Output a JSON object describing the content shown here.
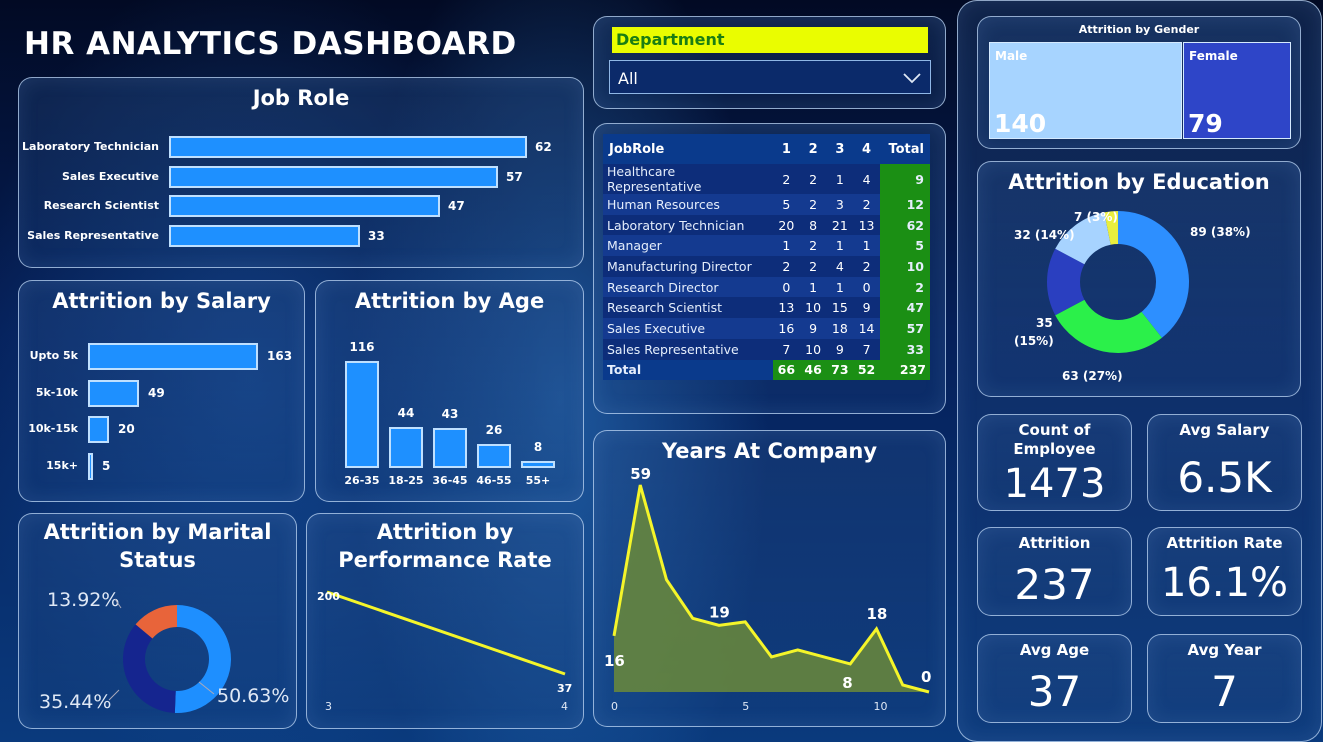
{
  "title": "HR ANALYTICS DASHBOARD",
  "job_role": {
    "title": "Job Role",
    "items": [
      {
        "label": "Laboratory Technician",
        "value": 62
      },
      {
        "label": "Sales Executive",
        "value": 57
      },
      {
        "label": "Research Scientist",
        "value": 47
      },
      {
        "label": "Sales Representative",
        "value": 33
      }
    ]
  },
  "salary": {
    "title": "Attrition by Salary",
    "items": [
      {
        "label": "Upto 5k",
        "value": 163
      },
      {
        "label": "5k-10k",
        "value": 49
      },
      {
        "label": "10k-15k",
        "value": 20
      },
      {
        "label": "15k+",
        "value": 5
      }
    ]
  },
  "age": {
    "title": "Attrition by Age",
    "items": [
      {
        "label": "26-35",
        "value": 116
      },
      {
        "label": "18-25",
        "value": 44
      },
      {
        "label": "36-45",
        "value": 43
      },
      {
        "label": "46-55",
        "value": 26
      },
      {
        "label": "55+",
        "value": 8
      }
    ]
  },
  "marital": {
    "title": "Attrition by Marital Status",
    "title_line1": "Attrition by Marital",
    "title_line2": "Status",
    "labels": [
      "13.92%",
      "35.44%",
      "50.63%"
    ],
    "colors": [
      "#e8643a",
      "#15258f",
      "#1e8fff"
    ]
  },
  "performance": {
    "title_line1": "Attrition by",
    "title_line2": "Performance Rate",
    "x_labels": [
      "3",
      "4"
    ],
    "point_labels": [
      "200",
      "37"
    ]
  },
  "department": {
    "label": "Department",
    "selected": "All",
    "chevron_icon": "chevron-down-icon"
  },
  "table": {
    "headers": [
      "JobRole",
      "1",
      "2",
      "3",
      "4",
      "Total"
    ],
    "rows": [
      [
        "Healthcare Representative",
        "2",
        "2",
        "1",
        "4",
        "9"
      ],
      [
        "Human Resources",
        "5",
        "2",
        "3",
        "2",
        "12"
      ],
      [
        "Laboratory Technician",
        "20",
        "8",
        "21",
        "13",
        "62"
      ],
      [
        "Manager",
        "1",
        "2",
        "1",
        "1",
        "5"
      ],
      [
        "Manufacturing Director",
        "2",
        "2",
        "4",
        "2",
        "10"
      ],
      [
        "Research Director",
        "0",
        "1",
        "1",
        "0",
        "2"
      ],
      [
        "Research Scientist",
        "13",
        "10",
        "15",
        "9",
        "47"
      ],
      [
        "Sales Executive",
        "16",
        "9",
        "18",
        "14",
        "57"
      ],
      [
        "Sales Representative",
        "7",
        "10",
        "9",
        "7",
        "33"
      ]
    ],
    "total": [
      "Total",
      "66",
      "46",
      "73",
      "52",
      "237"
    ]
  },
  "years": {
    "title": "Years At Company",
    "x_ticks": [
      "0",
      "5",
      "10"
    ],
    "labels": [
      "16",
      "59",
      "19",
      "8",
      "18",
      "0"
    ]
  },
  "gender": {
    "title": "Attrition by Gender",
    "male_label": "Male",
    "male_value": "140",
    "female_label": "Female",
    "female_value": "79"
  },
  "education": {
    "title": "Attrition by Education",
    "labels": [
      "89 (38%)",
      "63 (27%)",
      "35",
      "(15%)",
      "32 (14%)",
      "7 (3%)"
    ],
    "colors": [
      "#2d8fff",
      "#2bf04a",
      "#2a3fc0",
      "#a7d3ff",
      "#e9ee3e",
      "#e07a5f"
    ]
  },
  "kpis": {
    "count_title_1": "Count of",
    "count_title_2": "Employee",
    "count_value": "1473",
    "salary_title": "Avg Salary",
    "salary_value": "6.5K",
    "attrition_title": "Attrition",
    "attrition_value": "237",
    "rate_title": "Attrition Rate",
    "rate_value": "16.1%",
    "age_title": "Avg Age",
    "age_value": "37",
    "year_title": "Avg Year",
    "year_value": "7"
  },
  "chart_data": [
    {
      "type": "bar",
      "title": "Job Role",
      "categories": [
        "Laboratory Technician",
        "Sales Executive",
        "Research Scientist",
        "Sales Representative"
      ],
      "values": [
        62,
        57,
        47,
        33
      ]
    },
    {
      "type": "bar",
      "title": "Attrition by Salary",
      "categories": [
        "Upto 5k",
        "5k-10k",
        "10k-15k",
        "15k+"
      ],
      "values": [
        163,
        49,
        20,
        5
      ]
    },
    {
      "type": "bar",
      "title": "Attrition by Age",
      "categories": [
        "26-35",
        "18-25",
        "36-45",
        "46-55",
        "55+"
      ],
      "values": [
        116,
        44,
        43,
        26,
        8
      ]
    },
    {
      "type": "pie",
      "title": "Attrition by Marital Status",
      "values": [
        13.92,
        35.44,
        50.63
      ]
    },
    {
      "type": "line",
      "title": "Attrition by Performance Rate",
      "x": [
        3,
        4
      ],
      "values": [
        200,
        37
      ]
    },
    {
      "type": "area",
      "title": "Years At Company",
      "x": [
        0,
        1,
        2,
        3,
        4,
        5,
        6,
        7,
        8,
        9,
        10,
        11,
        12
      ],
      "values": [
        16,
        59,
        32,
        21,
        19,
        20,
        10,
        12,
        10,
        8,
        18,
        2,
        0
      ]
    },
    {
      "type": "bar",
      "title": "Attrition by Gender",
      "categories": [
        "Male",
        "Female"
      ],
      "values": [
        140,
        79
      ]
    },
    {
      "type": "pie",
      "title": "Attrition by Education",
      "values": [
        89,
        63,
        35,
        32,
        7
      ],
      "percent": [
        38,
        27,
        15,
        14,
        3
      ]
    }
  ]
}
